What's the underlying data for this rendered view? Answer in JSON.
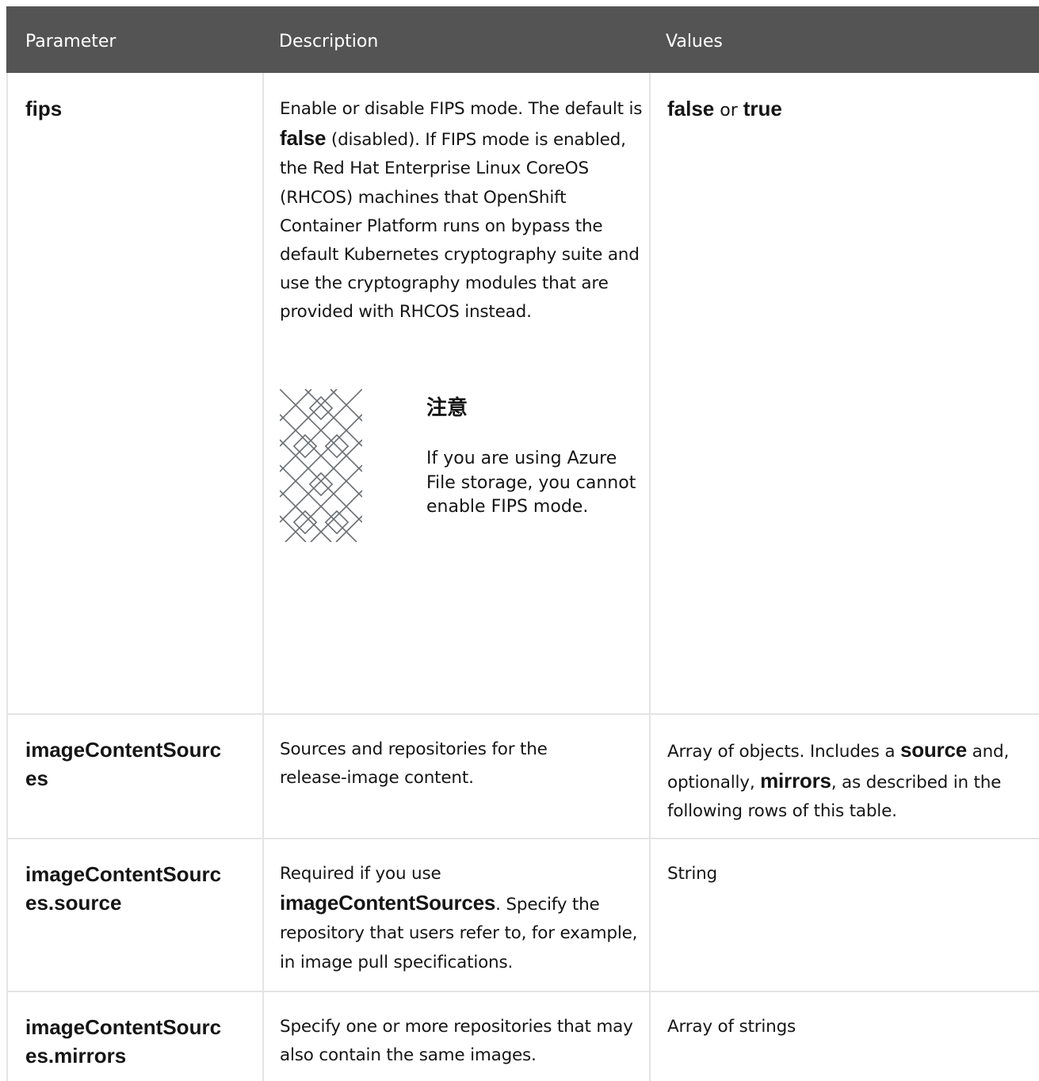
{
  "header": {
    "parameter": "Parameter",
    "description": "Description",
    "values": "Values"
  },
  "rows": [
    {
      "param_line1": "fips",
      "desc_parts": {
        "a": "Enable or disable FIPS mode. The default is ",
        "b": "false",
        "c": " (disabled). If FIPS mode is enabled, the Red Hat Enterprise Linux CoreOS (RHCOS) machines that OpenShift Container Platform runs on bypass the default Kubernetes cryptography suite and use the cryptography modules that are provided with RHCOS instead."
      },
      "note": {
        "title": "注意",
        "body": "If you are using Azure File storage, you cannot enable FIPS mode."
      },
      "values_parts": {
        "a": "false",
        "b": " or ",
        "c": "true"
      }
    },
    {
      "param_line1": "imageContentSourc",
      "param_line2": "es",
      "desc": "Sources and repositories for the release-image content.",
      "values_parts": {
        "a": "Array of objects. Includes a ",
        "b": "source",
        "c": " and, optionally, ",
        "d": "mirrors",
        "e": ", as described in the following rows of this table."
      }
    },
    {
      "param_line1": "imageContentSourc",
      "param_line2": "es.source",
      "desc_parts": {
        "a": "Required if you use ",
        "b": "imageContentSources",
        "c": ". Specify the repository that users refer to, for example, in image pull specifications."
      },
      "values": "String"
    },
    {
      "param_line1": "imageContentSourc",
      "param_line2": "es.mirrors",
      "desc": "Specify one or more repositories that may also contain the same images.",
      "values": "Array of strings"
    }
  ]
}
